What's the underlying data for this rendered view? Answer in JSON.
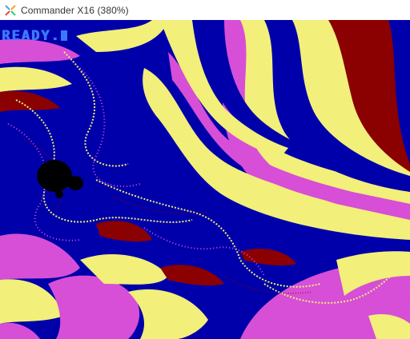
{
  "window": {
    "title": "Commander X16 (380%)",
    "icon": "x16-logo-icon"
  },
  "screen": {
    "prompt": "READY.",
    "palette": {
      "black": "#000000",
      "blue": "#0000aa",
      "violet": "#d64fd6",
      "yellow": "#f2ef7a",
      "darkred": "#8b0000",
      "textblue": "#3c78ff"
    }
  }
}
